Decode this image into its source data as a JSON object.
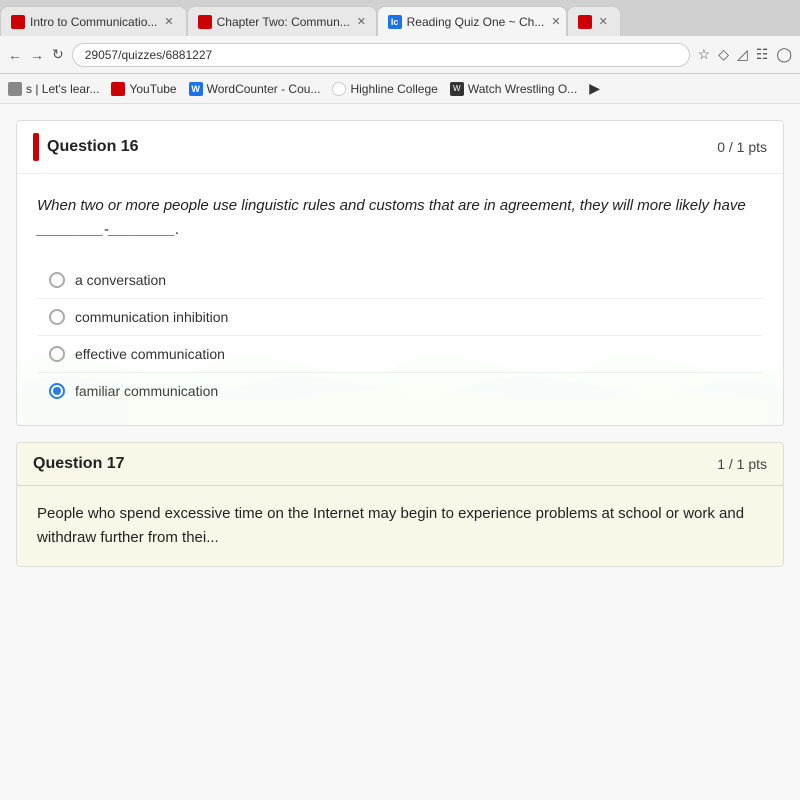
{
  "browser": {
    "tabs": [
      {
        "id": "tab1",
        "label": "Intro to Communicatio...",
        "icon_color": "red",
        "active": false
      },
      {
        "id": "tab2",
        "label": "Chapter Two: Commun...",
        "icon_color": "red",
        "active": false
      },
      {
        "id": "tab3",
        "label": "Reading Quiz One ~ Ch...",
        "icon_color": "blue-dark",
        "active": true
      },
      {
        "id": "tab4",
        "label": "...",
        "icon_color": "red",
        "active": false
      }
    ],
    "address_bar": "29057/quizzes/6881227",
    "nav_icons": [
      "back",
      "forward",
      "star",
      "diamond",
      "shield",
      "grid"
    ],
    "bookmarks": [
      {
        "label": "s | Let's lear...",
        "icon_color": "gray"
      },
      {
        "label": "YouTube",
        "icon_color": "red"
      },
      {
        "label": "WordCounter - Cou...",
        "icon_color": "blue"
      },
      {
        "label": "Highline College",
        "icon_color": "green"
      },
      {
        "label": "Watch Wrestling O...",
        "icon_color": "orange"
      }
    ]
  },
  "page": {
    "question16": {
      "title": "Question 16",
      "points": "0 / 1 pts",
      "question_text": "When two or more people use linguistic rules and customs that are in agreement, they will more likely have ________-________.",
      "options": [
        {
          "id": "opt1",
          "label": "a conversation",
          "selected": false
        },
        {
          "id": "opt2",
          "label": "communication inhibition",
          "selected": false
        },
        {
          "id": "opt3",
          "label": "effective communication",
          "selected": false
        },
        {
          "id": "opt4",
          "label": "familiar communication",
          "selected": true
        }
      ]
    },
    "question17": {
      "title": "Question 17",
      "points": "1 / 1 pts",
      "question_text": "People who spend excessive time on the Internet may begin to experience problems at school or work and withdraw further from thei..."
    }
  }
}
